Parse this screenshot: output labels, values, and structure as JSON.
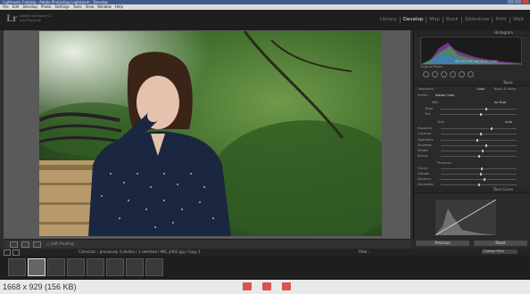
{
  "window": {
    "title": "Lightroom Catalog - Adobe Photoshop Lightroom - Develop"
  },
  "menu": [
    "File",
    "Edit",
    "Develop",
    "Photo",
    "Settings",
    "Tools",
    "View",
    "Window",
    "Help"
  ],
  "identity": {
    "logo": "Lr",
    "line1": "Adobe Lightroom CC",
    "line2": "Julia Puszcrak"
  },
  "modules": [
    {
      "label": "Library",
      "active": false
    },
    {
      "label": "Develop",
      "active": true
    },
    {
      "label": "Map",
      "active": false
    },
    {
      "label": "Book",
      "active": false
    },
    {
      "label": "Slideshow",
      "active": false
    },
    {
      "label": "Print",
      "active": false
    },
    {
      "label": "Web",
      "active": false
    }
  ],
  "right_panel": {
    "histogram_label": "Histogram",
    "histogram_values": "ISO 400   50 mm   f/2.8   1/160",
    "original_photo": "Original Photo",
    "basic_label": "Basic",
    "treatment": "Treatment :",
    "color": "Color",
    "bw": "Black & White",
    "profile": "Profile :",
    "profile_value": "Adobe Color",
    "wb": "WB :",
    "wb_value": "As Shot",
    "temp": "Temp",
    "tint": "Tint",
    "tone": "Tone",
    "auto": "Auto",
    "exposure": "Exposure",
    "contrast": "Contrast",
    "highlights": "Highlights",
    "shadows": "Shadows",
    "whites": "Whites",
    "blacks": "Blacks",
    "presence": "Presence",
    "clarity": "Clarity",
    "dehaze": "Dehaze",
    "vibrance": "Vibrance",
    "saturation": "Saturation",
    "tone_curve_label": "Tone Curve",
    "previous": "Previous",
    "reset": "Reset"
  },
  "toolbar": {
    "soft_proofing": "Soft Proofing"
  },
  "filmstrip": {
    "path": "Collection : previously   4 photos / 1 selected / IMG_4362.jpg / Copy 1",
    "filter": "Filter :",
    "custom_filter": "Custom Filter"
  },
  "info_bar": {
    "text": "1668 x 929 (156 KB)"
  }
}
